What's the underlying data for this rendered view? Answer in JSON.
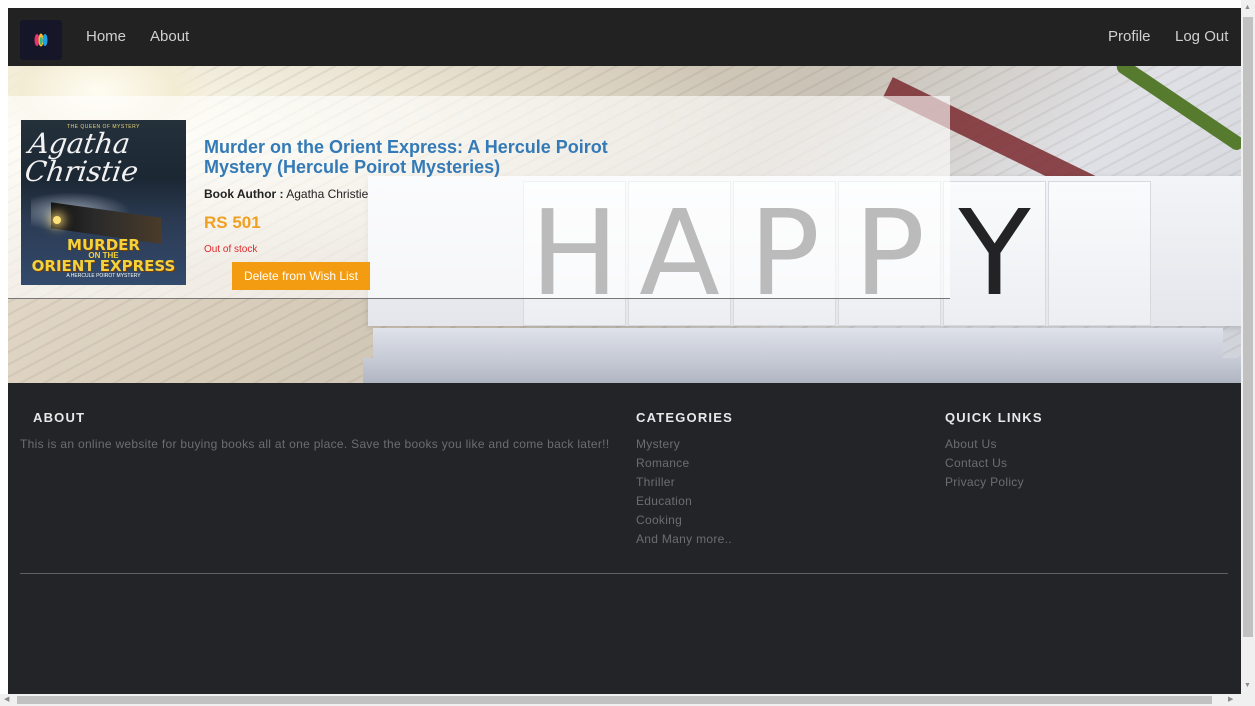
{
  "navbar": {
    "brand_icon": "colorful-feather-logo",
    "links_left": [
      "Home",
      "About"
    ],
    "links_right": [
      "Profile",
      "Log Out"
    ]
  },
  "hero": {
    "background_letters": [
      "H",
      "A",
      "P",
      "P",
      "Y"
    ]
  },
  "book": {
    "cover_top": "THE QUEEN OF MYSTERY",
    "cover_author": "Agatha Christie",
    "cover_title_1": "MURDER",
    "cover_title_2": "ON THE",
    "cover_title_3": "ORIENT EXPRESS",
    "cover_subtitle": "A HERCULE POIROT MYSTERY",
    "title": "Murder on the Orient Express: A Hercule Poirot Mystery (Hercule Poirot Mysteries)",
    "author_label": "Book Author :",
    "author": "Agatha Christie",
    "price": "RS 501",
    "stock_status": "Out of stock",
    "delete_label": "Delete from Wish List"
  },
  "footer": {
    "about": {
      "heading": "ABOUT",
      "text": "This is an online website for buying books all at one place. Save the books you like and come back later!!"
    },
    "categories": {
      "heading": "CATEGORIES",
      "items": [
        "Mystery",
        "Romance",
        "Thriller",
        "Education",
        "Cooking",
        "And Many more.."
      ]
    },
    "quick_links": {
      "heading": "QUICK LINKS",
      "items": [
        "About Us",
        "Contact Us",
        "Privacy Policy"
      ]
    }
  },
  "colors": {
    "navbar_bg": "#222222",
    "footer_bg": "#232428",
    "title_blue": "#337ab7",
    "price_orange": "#f0a020",
    "button_orange": "#f39c12",
    "stock_red": "#e0282a"
  }
}
